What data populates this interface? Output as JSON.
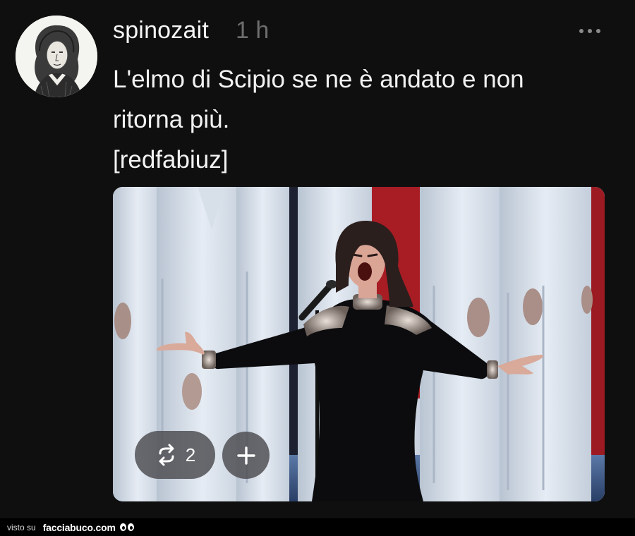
{
  "post": {
    "username": "spinozait",
    "timestamp": "1 h",
    "text_lines": [
      "L'elmo di Scipio se ne è andato e non",
      "ritorna più.",
      "[redfabiuz]"
    ],
    "actions": {
      "repost_count": "2"
    },
    "icons": {
      "more": "more-horizontal-icon",
      "repost": "repost-icon",
      "add": "plus-icon"
    }
  },
  "footer": {
    "prefix": "visto su",
    "site": "facciabuco.com"
  },
  "colors": {
    "background": "#0f0f0f",
    "text": "#f2f2f2",
    "muted": "#6d6d6d",
    "pill": "#4b4b4e"
  }
}
